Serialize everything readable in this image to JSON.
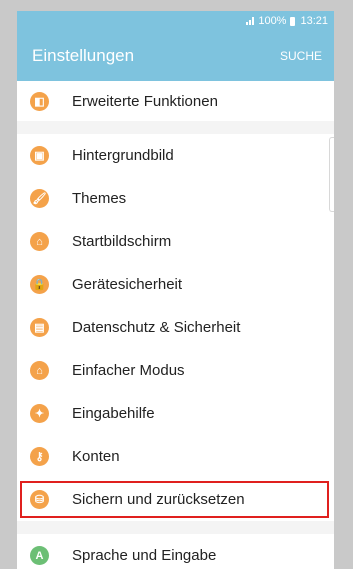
{
  "status": {
    "battery": "100%",
    "time": "13:21"
  },
  "appbar": {
    "title": "Einstellungen",
    "search_label": "SUCHE"
  },
  "settings": [
    {
      "label": "Erweiterte Funktionen",
      "icon": "extended-features-icon",
      "icon_glyph": "◧"
    },
    {
      "label": "Hintergrundbild",
      "icon": "wallpaper-icon",
      "icon_glyph": "▣"
    },
    {
      "label": "Themes",
      "icon": "themes-icon",
      "icon_glyph": "🖌"
    },
    {
      "label": "Startbildschirm",
      "icon": "home-icon",
      "icon_glyph": "⌂"
    },
    {
      "label": "Gerätesicherheit",
      "icon": "lock-icon",
      "icon_glyph": "🔒"
    },
    {
      "label": "Datenschutz & Sicherheit",
      "icon": "privacy-icon",
      "icon_glyph": "▤"
    },
    {
      "label": "Einfacher Modus",
      "icon": "easy-mode-icon",
      "icon_glyph": "⌂"
    },
    {
      "label": "Eingabehilfe",
      "icon": "accessibility-icon",
      "icon_glyph": "✦"
    },
    {
      "label": "Konten",
      "icon": "key-icon",
      "icon_glyph": "⚷"
    },
    {
      "label": "Sichern und zurücksetzen",
      "icon": "backup-reset-icon",
      "icon_glyph": "⛁",
      "highlighted": true
    },
    {
      "label": "Sprache und Eingabe",
      "icon": "language-input-icon",
      "icon_glyph": "A"
    }
  ],
  "colors": {
    "appbar": "#7ec3de",
    "icon_orange": "#f4a24a",
    "icon_green": "#6cbf75",
    "highlight_border": "#e0201e"
  }
}
